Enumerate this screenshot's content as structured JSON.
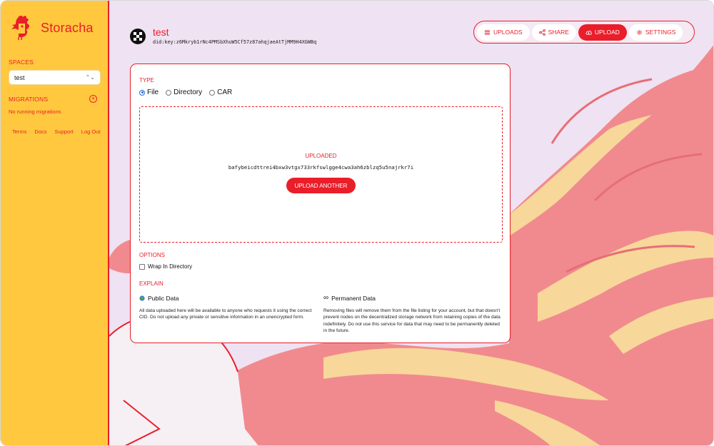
{
  "sidebar": {
    "brand": "Storacha",
    "spaces_title": "Spaces",
    "selected_space": "test",
    "migrations_title": "Migrations",
    "migrations_empty": "No running migrations",
    "links": [
      "Terms",
      "Docs",
      "Support",
      "Log Out"
    ]
  },
  "header": {
    "space_name": "test",
    "space_did": "did:key:z6Mkryb1rNc4PMSbXhuW5Cf57z87ahqjaeAtTjMM9H4XGWBq"
  },
  "nav": {
    "uploads": "Uploads",
    "share": "Share",
    "upload": "Upload",
    "settings": "Settings",
    "active": "upload"
  },
  "upload_card": {
    "type_title": "Type",
    "type_options": [
      "File",
      "Directory",
      "CAR"
    ],
    "selected_type": "File",
    "uploaded_label": "Uploaded",
    "cid": "bafybeicdttrei4bxw3vtgx733rkfswlgge4cwa3ah6zblzq5u5najrkr7i",
    "upload_another": "Upload Another",
    "options_title": "Options",
    "wrap_in_directory": "Wrap In Directory",
    "explain_title": "Explain",
    "public_title": "Public Data",
    "public_body": "All data uploaded here will be available to anyone who requests it using the correct CID. Do not upload any private or sensitive information in an unencrypted form.",
    "permanent_title": "Permanent Data",
    "permanent_body": "Removing files will remove them from the file listing for your account, but that doesn't prevent nodes on the decentralized storage network from retaining copies of the data indefinitely. Do not use this service for data that may need to be permanently deleted in the future."
  },
  "colors": {
    "accent": "#e91e2a",
    "sidebar_bg": "#ffc83f",
    "main_bg": "#efe2f2",
    "art_pink": "#f18a8e",
    "art_cream": "#f7d79a"
  }
}
